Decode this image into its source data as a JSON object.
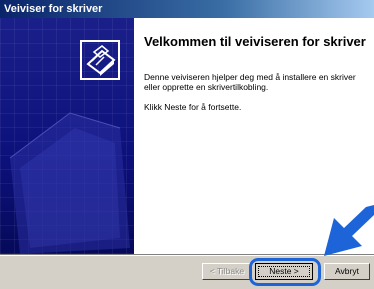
{
  "window": {
    "title": "Veiviser for skriver"
  },
  "content": {
    "heading": "Velkommen til veiviseren for skriver",
    "description": "Denne veiviseren hjelper deg med å installere en skriver eller opprette en skrivertilkobling.",
    "instruction": "Klikk Neste for å fortsette."
  },
  "buttons": {
    "back": "< Tilbake",
    "next": "Neste >",
    "cancel": "Avbryt"
  },
  "icons": {
    "wizard": "printer-icon",
    "annotation": "pointer-arrow-icon"
  },
  "colors": {
    "titlebar_start": "#0a246a",
    "sidebar": "#0c107a",
    "highlight": "#1c64d8"
  }
}
